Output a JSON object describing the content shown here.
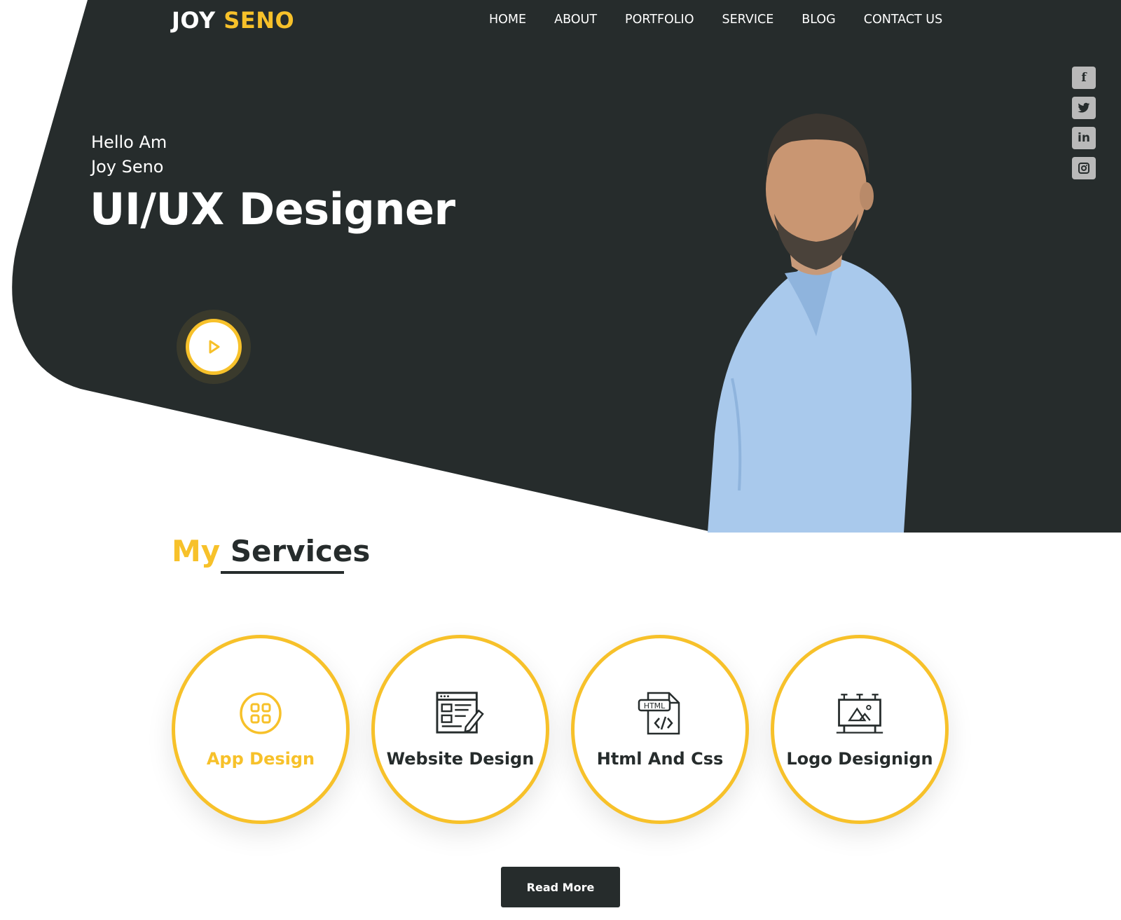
{
  "brand": {
    "first": "JOY",
    "second": "SENO"
  },
  "nav": {
    "items": [
      "HOME",
      "ABOUT",
      "PORTFOLIO",
      "SERVICE",
      "BLOG",
      "CONTACT US"
    ]
  },
  "social": {
    "items": [
      {
        "label": "f",
        "icon": "facebook-icon"
      },
      {
        "label": "twitter",
        "icon": "twitter-icon"
      },
      {
        "label": "in",
        "icon": "linkedin-icon"
      },
      {
        "label": "instagram",
        "icon": "instagram-icon"
      }
    ]
  },
  "hero": {
    "greeting": "Hello Am",
    "name": "Joy Seno",
    "role": "UI/UX Designer"
  },
  "services": {
    "title_accent": "My",
    "title_main": "Services",
    "items": [
      {
        "label": "App Design",
        "icon": "app-grid-icon"
      },
      {
        "label": "Website Design",
        "icon": "website-design-icon"
      },
      {
        "label": "Html And Css",
        "icon": "html-file-icon"
      },
      {
        "label": "Logo Designign",
        "icon": "billboard-icon"
      }
    ]
  },
  "cta": {
    "read_more": "Read More"
  },
  "colors": {
    "dark": "#262c2c",
    "accent": "#f7c12a",
    "white": "#ffffff",
    "social_bg": "#b9b9b9"
  }
}
